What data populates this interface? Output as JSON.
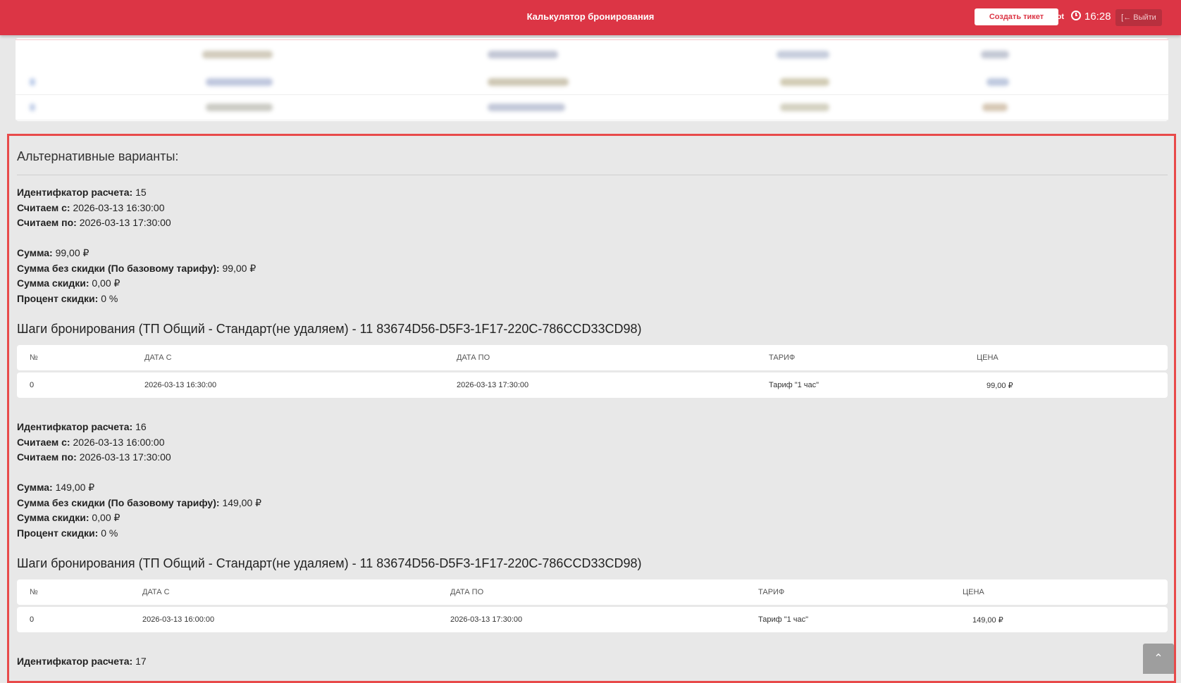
{
  "header": {
    "title": "Калькулятор бронирования",
    "create_ticket_label": "Создать тикет",
    "user": "Root",
    "time": "16:28",
    "logout_label": "Выйти"
  },
  "alternatives": {
    "title": "Альтернативные варианты:",
    "labels": {
      "calc_id": "Идентифкатор расчета:",
      "from": "Считаем с:",
      "to": "Считаем по:",
      "sum": "Сумма:",
      "sum_no_discount": "Сумма без скидки (По базовому тарифу):",
      "discount_sum": "Сумма скидки:",
      "discount_percent": "Процент скидки:"
    },
    "table_headers": [
      "№",
      "ДАТА С",
      "ДАТА ПО",
      "ТАРИФ",
      "ЦЕНА"
    ],
    "variants": [
      {
        "calc_id": "15",
        "from": "2026-03-13 16:30:00",
        "to": "2026-03-13 17:30:00",
        "sum": "99,00 ₽",
        "sum_no_discount": "99,00 ₽",
        "discount_sum": "0,00 ₽",
        "discount_percent": "0 %",
        "steps_title": "Шаги бронирования (ТП Общий - Стандарт(не удаляем) - 11 83674D56-D5F3-1F17-220C-786CCD33CD98)",
        "rows": [
          {
            "n": "0",
            "from": "2026-03-13 16:30:00",
            "to": "2026-03-13 17:30:00",
            "tariff": "Тариф \"1 час\"",
            "price": "99,00 ₽"
          }
        ]
      },
      {
        "calc_id": "16",
        "from": "2026-03-13 16:00:00",
        "to": "2026-03-13 17:30:00",
        "sum": "149,00 ₽",
        "sum_no_discount": "149,00 ₽",
        "discount_sum": "0,00 ₽",
        "discount_percent": "0 %",
        "steps_title": "Шаги бронирования (ТП Общий - Стандарт(не удаляем) - 11 83674D56-D5F3-1F17-220C-786CCD33CD98)",
        "rows": [
          {
            "n": "0",
            "from": "2026-03-13 16:00:00",
            "to": "2026-03-13 17:30:00",
            "tariff": "Тариф \"1 час\"",
            "price": "149,00 ₽"
          }
        ]
      },
      {
        "calc_id": "17"
      }
    ]
  },
  "icons": {
    "clock": "clock-icon",
    "logout": "sign-out-icon",
    "scroll_top": "chevron-up-icon"
  },
  "colors": {
    "brand": "#dc3545",
    "highlight": "#e84a4a",
    "background": "#e8e8e8"
  }
}
